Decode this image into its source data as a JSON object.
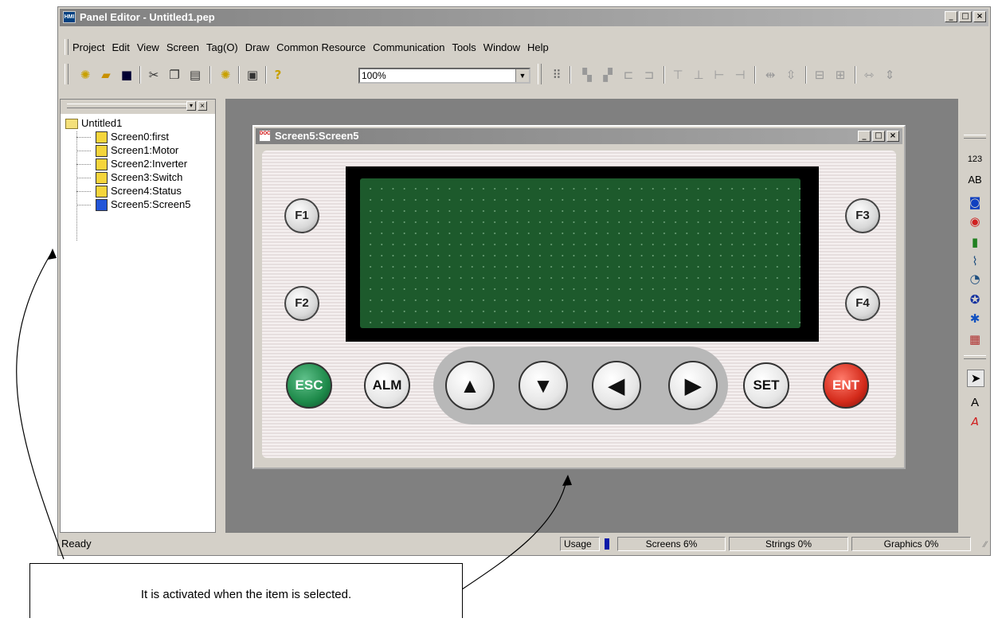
{
  "window": {
    "title": "Panel Editor - Untitled1.pep",
    "app_icon_text": "HMI"
  },
  "window_buttons": {
    "minimize": "_",
    "maximize": "□",
    "close": "×"
  },
  "menu": [
    "Project",
    "Edit",
    "View",
    "Screen",
    "Tag(O)",
    "Draw",
    "Common Resource",
    "Communication",
    "Tools",
    "Window",
    "Help"
  ],
  "toolbar": {
    "zoom": "100%",
    "zoom_arrow": "▼"
  },
  "tree": {
    "root": "Untitled1",
    "items": [
      {
        "label": "Screen0:first",
        "color": "#f5d53b"
      },
      {
        "label": "Screen1:Motor",
        "color": "#f5d53b"
      },
      {
        "label": "Screen2:Inverter",
        "color": "#f5d53b"
      },
      {
        "label": "Screen3:Switch",
        "color": "#f5d53b"
      },
      {
        "label": "Screen4:Status",
        "color": "#f5d53b"
      },
      {
        "label": "Screen5:Screen5",
        "color": "#2255d8"
      }
    ]
  },
  "screen_window": {
    "title": "Screen5:Screen5",
    "keys": {
      "f1": "F1",
      "f2": "F2",
      "f3": "F3",
      "f4": "F4",
      "esc": "ESC",
      "alm": "ALM",
      "up": "▲",
      "down": "▼",
      "left": "◀",
      "right": "▶",
      "set": "SET",
      "ent": "ENT"
    },
    "colors": {
      "lcd": "#1d5a2c",
      "esc": "#1e8a4a",
      "ent": "#d42b1b"
    }
  },
  "right_toolbar": {
    "numeric": "123",
    "text": "AB",
    "text_tool": "A"
  },
  "status": {
    "text": "Ready",
    "usage_label": "Usage",
    "screens": "Screens  6%",
    "strings": "Strings  0%",
    "graphics": "Graphics  0%"
  },
  "annotation": "It is activated when the item is selected."
}
